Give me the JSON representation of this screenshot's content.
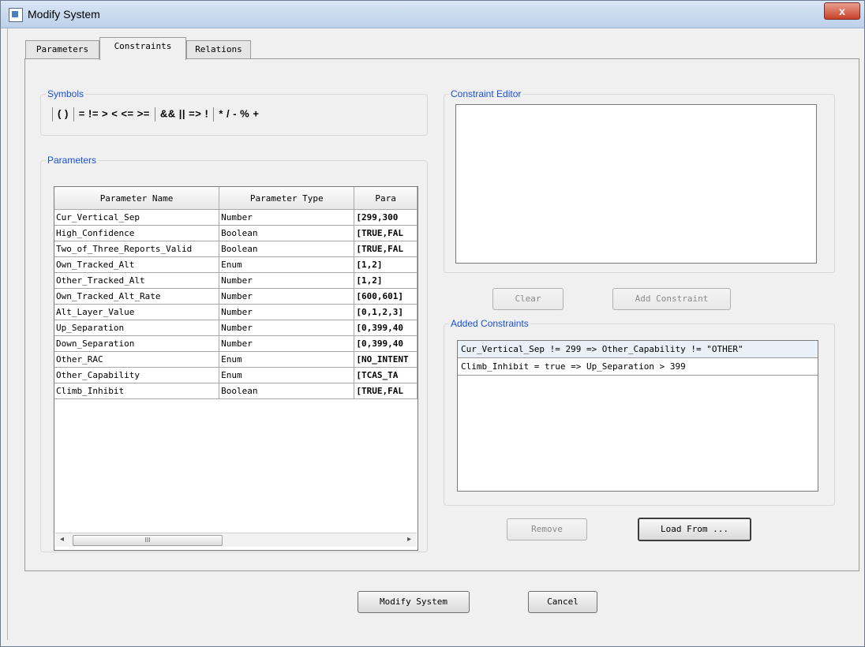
{
  "window": {
    "title": "Modify System",
    "close_glyph": "x"
  },
  "tabs": [
    {
      "label": "Parameters"
    },
    {
      "label": "Constraints"
    },
    {
      "label": "Relations"
    }
  ],
  "symbols": {
    "legend": "Symbols",
    "group1": "( )",
    "group2": "= != > < <= >=",
    "group3": "&& || => !",
    "group4": "* / - % +"
  },
  "parameters": {
    "legend": "Parameters",
    "columns": [
      "Parameter Name",
      "Parameter Type",
      "Para"
    ],
    "rows": [
      {
        "name": "Cur_Vertical_Sep",
        "type": "Number",
        "value": "[299,300"
      },
      {
        "name": "High_Confidence",
        "type": "Boolean",
        "value": "[TRUE,FAL"
      },
      {
        "name": "Two_of_Three_Reports_Valid",
        "type": "Boolean",
        "value": "[TRUE,FAL"
      },
      {
        "name": "Own_Tracked_Alt",
        "type": "Enum",
        "value": "[1,2]"
      },
      {
        "name": "Other_Tracked_Alt",
        "type": "Number",
        "value": "[1,2]"
      },
      {
        "name": "Own_Tracked_Alt_Rate",
        "type": "Number",
        "value": "[600,601]"
      },
      {
        "name": "Alt_Layer_Value",
        "type": "Number",
        "value": "[0,1,2,3]"
      },
      {
        "name": "Up_Separation",
        "type": "Number",
        "value": "[0,399,40"
      },
      {
        "name": "Down_Separation",
        "type": "Number",
        "value": "[0,399,40"
      },
      {
        "name": "Other_RAC",
        "type": "Enum",
        "value": "[NO_INTENT"
      },
      {
        "name": "Other_Capability",
        "type": "Enum",
        "value": "[TCAS_TA"
      },
      {
        "name": "Climb_Inhibit",
        "type": "Boolean",
        "value": "[TRUE,FAL"
      }
    ],
    "scroll_thumb_grip": "III",
    "scroll_left_glyph": "◂",
    "scroll_right_glyph": "▸"
  },
  "constraint_editor": {
    "legend": "Constraint Editor",
    "text": ""
  },
  "buttons": {
    "clear": "Clear",
    "add_constraint": "Add Constraint",
    "remove": "Remove",
    "load_from": "Load From ...",
    "modify_system": "Modify System",
    "cancel": "Cancel"
  },
  "added_constraints": {
    "legend": "Added Constraints",
    "items": [
      "Cur_Vertical_Sep != 299 => Other_Capability != \"OTHER\"",
      "Climb_Inhibit = true => Up_Separation > 399"
    ]
  }
}
